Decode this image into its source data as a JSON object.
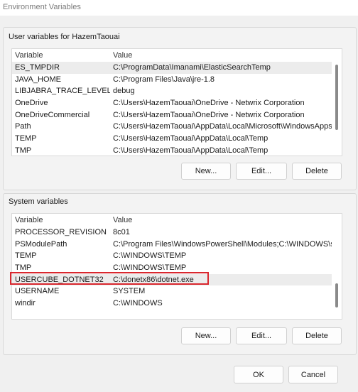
{
  "window": {
    "title": "Environment Variables"
  },
  "user_section": {
    "label": "User variables for HazemTaouai",
    "columns": {
      "variable": "Variable",
      "value": "Value"
    },
    "rows": [
      {
        "name": "ES_TMPDIR",
        "value": "C:\\ProgramData\\Imanami\\ElasticSearchTemp",
        "selected": true
      },
      {
        "name": "JAVA_HOME",
        "value": "C:\\Program Files\\Java\\jre-1.8"
      },
      {
        "name": "LIBJABRA_TRACE_LEVEL",
        "value": "debug"
      },
      {
        "name": "OneDrive",
        "value": "C:\\Users\\HazemTaouai\\OneDrive - Netwrix Corporation"
      },
      {
        "name": "OneDriveCommercial",
        "value": "C:\\Users\\HazemTaouai\\OneDrive - Netwrix Corporation"
      },
      {
        "name": "Path",
        "value": "C:\\Users\\HazemTaouai\\AppData\\Local\\Microsoft\\WindowsApps;..."
      },
      {
        "name": "TEMP",
        "value": "C:\\Users\\HazemTaouai\\AppData\\Local\\Temp"
      },
      {
        "name": "TMP",
        "value": "C:\\Users\\HazemTaouai\\AppData\\Local\\Temp"
      }
    ],
    "buttons": {
      "new": "New...",
      "edit": "Edit...",
      "delete": "Delete"
    }
  },
  "system_section": {
    "label": "System variables",
    "columns": {
      "variable": "Variable",
      "value": "Value"
    },
    "rows": [
      {
        "name": "PROCESSOR_REVISION",
        "value": "8c01"
      },
      {
        "name": "PSModulePath",
        "value": "C:\\Program Files\\WindowsPowerShell\\Modules;C:\\WINDOWS\\sy..."
      },
      {
        "name": "TEMP",
        "value": "C:\\WINDOWS\\TEMP"
      },
      {
        "name": "TMP",
        "value": "C:\\WINDOWS\\TEMP"
      },
      {
        "name": "USERCUBE_DOTNET32",
        "value": "C:\\donetx86\\dotnet.exe",
        "selected": true,
        "highlighted": true
      },
      {
        "name": "USERNAME",
        "value": "SYSTEM"
      },
      {
        "name": "windir",
        "value": "C:\\WINDOWS"
      }
    ],
    "buttons": {
      "new": "New...",
      "edit": "Edit...",
      "delete": "Delete"
    }
  },
  "footer": {
    "ok": "OK",
    "cancel": "Cancel"
  },
  "colors": {
    "highlight_border": "#d9272e",
    "selected_row": "#ececec",
    "scroll_thumb": "#8a8a8a"
  }
}
